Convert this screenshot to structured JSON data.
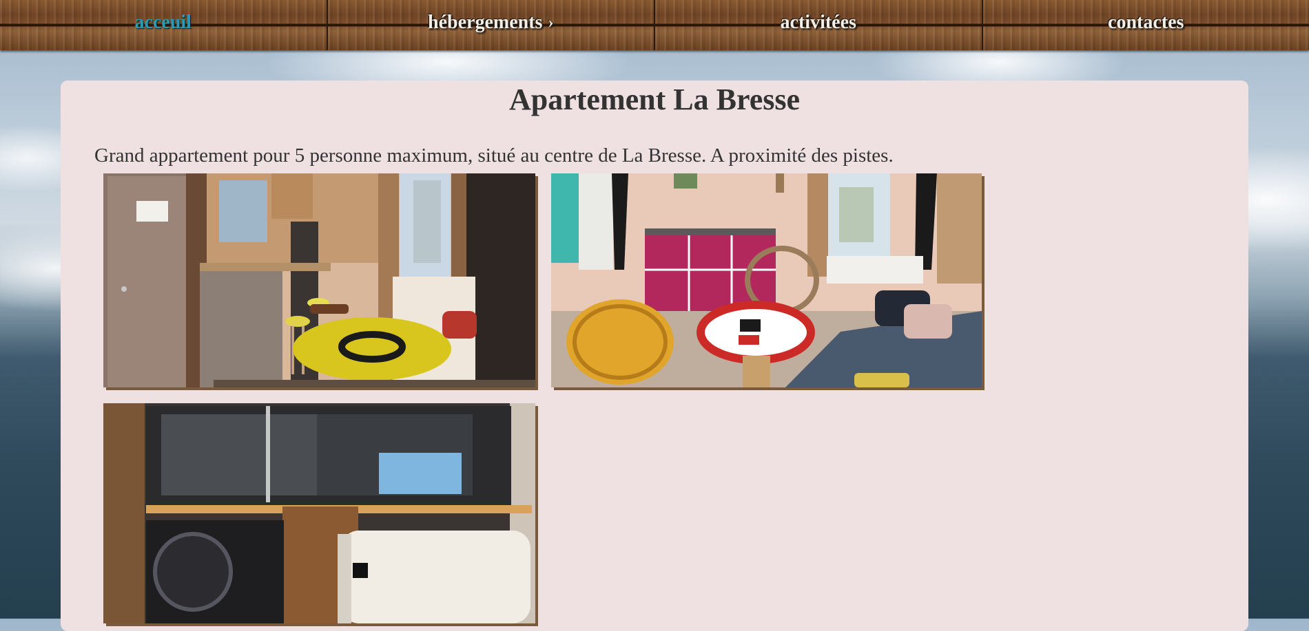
{
  "nav": {
    "items": [
      {
        "label": "acceuil",
        "active": true
      },
      {
        "label": "hébergements",
        "has_submenu": true,
        "submenu_icon": "chevron-right-icon"
      },
      {
        "label": "activitées"
      },
      {
        "label": "contactes"
      }
    ]
  },
  "page": {
    "title": "Apartement La Bresse",
    "description": "Grand appartement pour 5 personne maximum, situé au centre de La Bresse. A proximité des pistes."
  },
  "photos": [
    {
      "subject": "kitchen-dining-photo"
    },
    {
      "subject": "living-room-photo"
    },
    {
      "subject": "bathroom-photo"
    }
  ],
  "colors": {
    "active_nav": "#2a9ab4",
    "card_background": "#efe1e1",
    "text": "#333333",
    "nav_wood": "#6f4526"
  }
}
